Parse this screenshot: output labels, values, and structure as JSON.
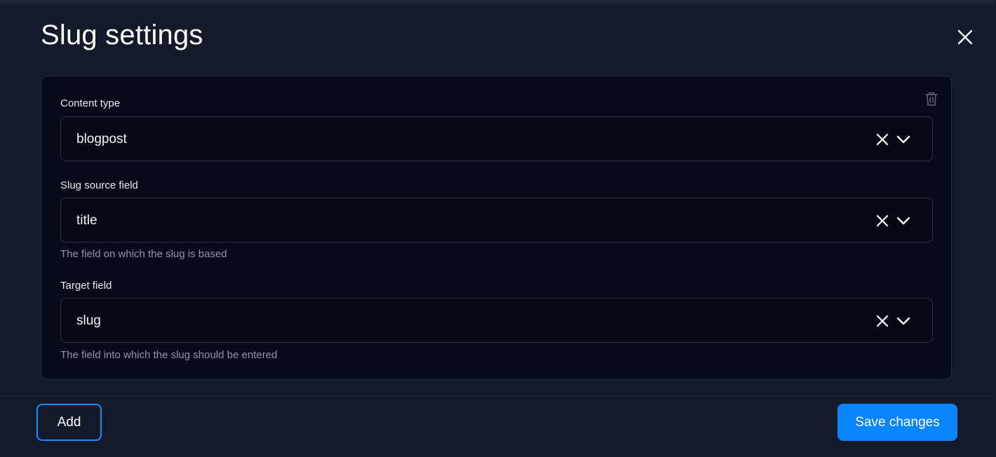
{
  "modal": {
    "title": "Slug settings"
  },
  "mappings": [
    {
      "fields": [
        {
          "label": "Content type",
          "value": "blogpost",
          "help": ""
        },
        {
          "label": "Slug source field",
          "value": "title",
          "help": "The field on which the slug is based"
        },
        {
          "label": "Target field",
          "value": "slug",
          "help": "The field into which the slug should be entered"
        }
      ]
    }
  ],
  "footer": {
    "add_label": "Add",
    "save_label": "Save changes"
  },
  "icons": {
    "close": "close-icon",
    "delete": "trash-icon",
    "clear": "clear-x-icon",
    "expand": "chevron-down-icon"
  },
  "colors": {
    "background": "#121a2b",
    "panel": "#070a18",
    "accent": "#0a84ff",
    "help_text": "#8e96a8"
  }
}
